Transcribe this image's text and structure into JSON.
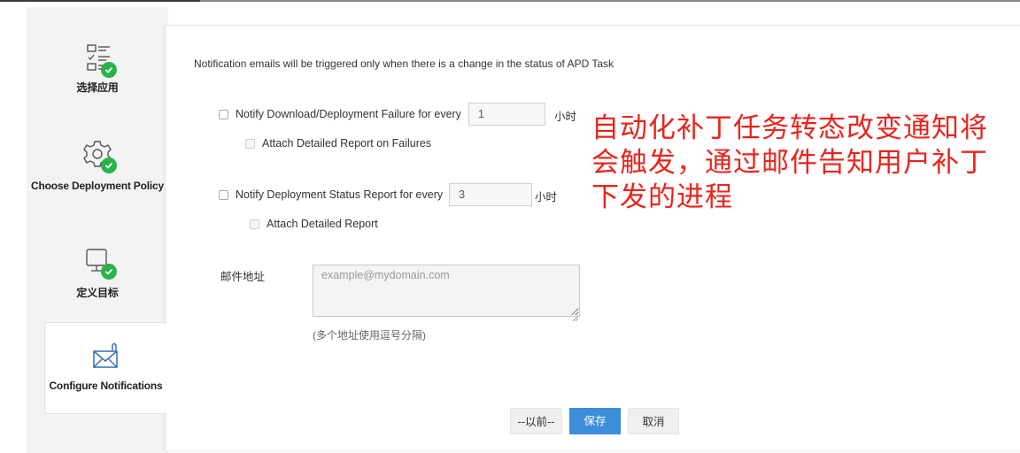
{
  "wizard": {
    "steps": [
      {
        "label": "选择应用",
        "icon": "checklist-icon",
        "status": "completed"
      },
      {
        "label": "Choose Deployment Policy",
        "icon": "gear-icon",
        "status": "completed"
      },
      {
        "label": "定义目标",
        "icon": "monitor-icon",
        "status": "completed"
      },
      {
        "label": "Configure Notifications",
        "icon": "envelope-icon",
        "status": "active"
      }
    ]
  },
  "notifications": {
    "notice": "Notification emails will be triggered only when there is a change in the status of APD Task",
    "failure": {
      "label": "Notify Download/Deployment Failure for every",
      "value": "1",
      "unit": "小时",
      "checked": false
    },
    "attach_failures": {
      "label": "Attach Detailed Report on Failures",
      "checked": false
    },
    "status": {
      "label": "Notify Deployment Status Report for every",
      "value": "3",
      "unit": "小时",
      "checked": false
    },
    "attach_report": {
      "label": "Attach Detailed Report",
      "checked": false
    },
    "email": {
      "label": "邮件地址",
      "placeholder": "example@mydomain.com",
      "hint": "(多个地址使用逗号分隔)"
    }
  },
  "annotation": "自动化补丁任务转态改变通知将会触发，通过邮件告知用户补丁下发的进程",
  "buttons": {
    "prev": "--以前--",
    "save": "保存",
    "cancel": "取消"
  },
  "colors": {
    "check": "#2ab34a",
    "primary": "#3c8ed8",
    "annotation": "#e8251c"
  }
}
